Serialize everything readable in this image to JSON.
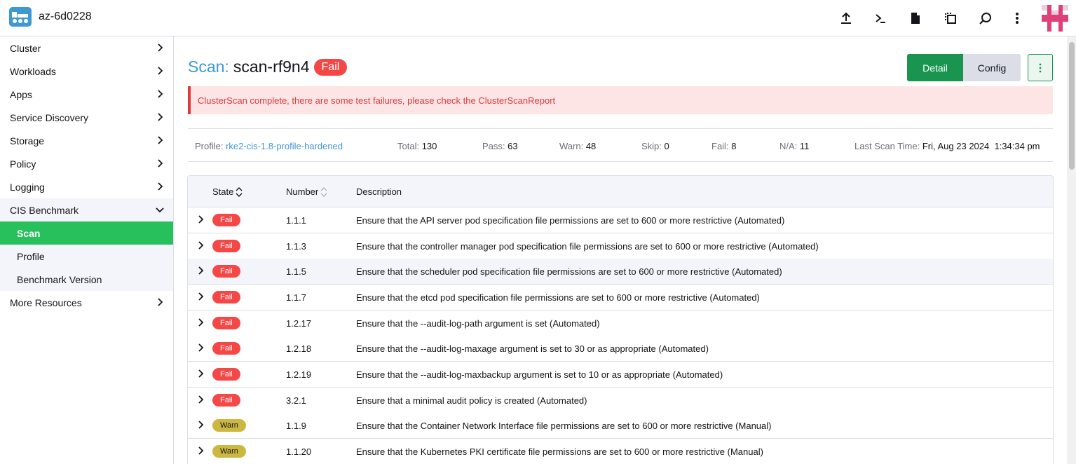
{
  "header": {
    "cluster_name": "az-6d0228",
    "icons": [
      "upload-icon",
      "terminal-icon",
      "file-icon",
      "copy-config-icon",
      "search-icon",
      "more-vertical-icon"
    ]
  },
  "sidebar": {
    "items": [
      {
        "label": "Cluster"
      },
      {
        "label": "Workloads"
      },
      {
        "label": "Apps"
      },
      {
        "label": "Service Discovery"
      },
      {
        "label": "Storage"
      },
      {
        "label": "Policy"
      },
      {
        "label": "Logging"
      },
      {
        "label": "CIS Benchmark"
      },
      {
        "label": "Scan"
      },
      {
        "label": "Profile"
      },
      {
        "label": "Benchmark Version"
      },
      {
        "label": "More Resources"
      }
    ]
  },
  "page": {
    "title_prefix": "Scan:",
    "title_name": "scan-rf9n4",
    "status": "Fail",
    "detail_label": "Detail",
    "config_label": "Config",
    "banner": "ClusterScan complete, there are some test failures, please check the ClusterScanReport"
  },
  "summary": {
    "profile_label": "Profile:",
    "profile_value": "rke2-cis-1.8-profile-hardened",
    "total_label": "Total:",
    "total_value": "130",
    "pass_label": "Pass:",
    "pass_value": "63",
    "warn_label": "Warn:",
    "warn_value": "48",
    "skip_label": "Skip:",
    "skip_value": "0",
    "fail_label": "Fail:",
    "fail_value": "8",
    "na_label": "N/A:",
    "na_value": "11",
    "last_scan_label": "Last Scan Time:",
    "last_scan_value": "Fri, Aug 23 2024  1:34:34 pm"
  },
  "table": {
    "headers": {
      "state": "State",
      "number": "Number",
      "description": "Description"
    },
    "rows": [
      {
        "state": "Fail",
        "number": "1.1.1",
        "description": "Ensure that the API server pod specification file permissions are set to 600 or more restrictive (Automated)"
      },
      {
        "state": "Fail",
        "number": "1.1.3",
        "description": "Ensure that the controller manager pod specification file permissions are set to 600 or more restrictive (Automated)"
      },
      {
        "state": "Fail",
        "number": "1.1.5",
        "description": "Ensure that the scheduler pod specification file permissions are set to 600 or more restrictive (Automated)"
      },
      {
        "state": "Fail",
        "number": "1.1.7",
        "description": "Ensure that the etcd pod specification file permissions are set to 600 or more restrictive (Automated)"
      },
      {
        "state": "Fail",
        "number": "1.2.17",
        "description": "Ensure that the --audit-log-path argument is set (Automated)"
      },
      {
        "state": "Fail",
        "number": "1.2.18",
        "description": "Ensure that the --audit-log-maxage argument is set to 30 or as appropriate (Automated)"
      },
      {
        "state": "Fail",
        "number": "1.2.19",
        "description": "Ensure that the --audit-log-maxbackup argument is set to 10 or as appropriate (Automated)"
      },
      {
        "state": "Fail",
        "number": "3.2.1",
        "description": "Ensure that a minimal audit policy is created (Automated)"
      },
      {
        "state": "Warn",
        "number": "1.1.9",
        "description": "Ensure that the Container Network Interface file permissions are set to 600 or more restrictive (Manual)"
      },
      {
        "state": "Warn",
        "number": "1.1.20",
        "description": "Ensure that the Kubernetes PKI certificate file permissions are set to 600 or more restrictive (Manual)"
      }
    ]
  },
  "colors": {
    "accent_green": "#27c05c",
    "primary_green": "#1a9550",
    "link_blue": "#3d98d3",
    "fail_red": "#f64747",
    "warn_yellow": "#ccb741"
  }
}
